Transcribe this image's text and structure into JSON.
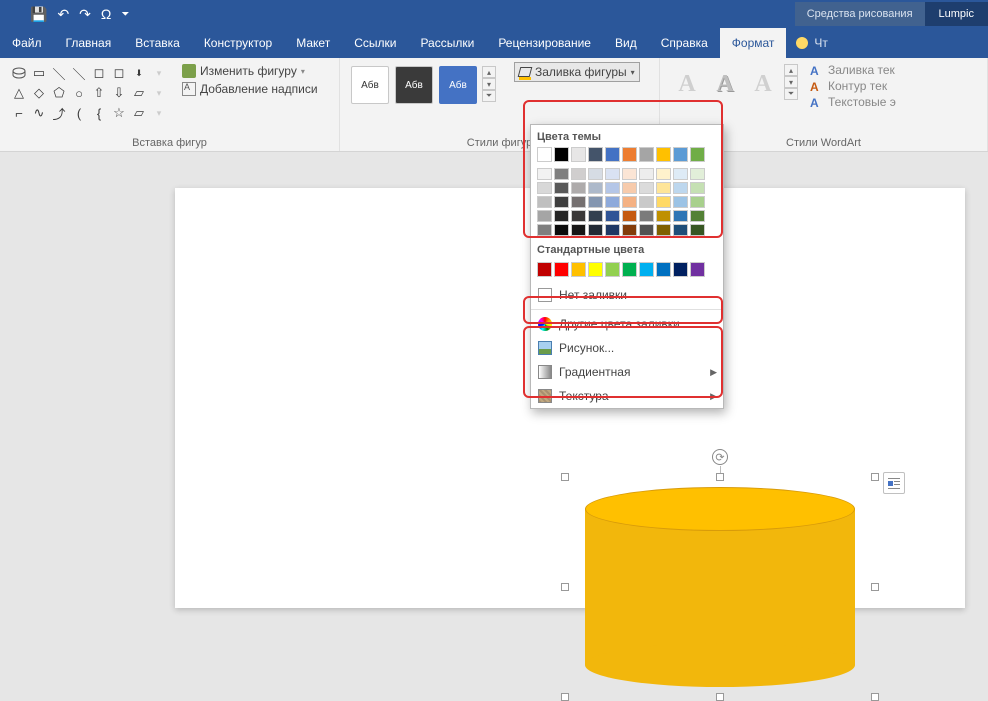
{
  "qat": {
    "save": "💾",
    "undo": "↶",
    "redo": "↷",
    "omega": "Ω",
    "more": "⏷"
  },
  "titlebar": {
    "tools": "Средства рисования",
    "brand": "Lumpic"
  },
  "menu": {
    "file": "Файл",
    "home": "Главная",
    "insert": "Вставка",
    "design": "Конструктор",
    "layout": "Макет",
    "refs": "Ссылки",
    "mail": "Рассылки",
    "review": "Рецензирование",
    "view": "Вид",
    "help": "Справка",
    "format": "Формат",
    "tellme": "Чт"
  },
  "ribbon": {
    "shapes_group": "Вставка фигур",
    "edit_shape": "Изменить фигуру",
    "add_text": "Добавление надписи",
    "styles_group": "Стили фигур",
    "preset": "Абв",
    "fill": "Заливка фигуры",
    "wordart_group": "Стили WordArt",
    "wa": "A",
    "wa_fill": "Заливка тек",
    "wa_outline": "Контур тек",
    "wa_effects": "Текстовые э"
  },
  "dropdown": {
    "theme_title": "Цвета темы",
    "theme_top": [
      "#ffffff",
      "#000000",
      "#e7e6e6",
      "#44546a",
      "#4472c4",
      "#ed7d31",
      "#a5a5a5",
      "#ffc000",
      "#5b9bd5",
      "#70ad47"
    ],
    "theme_shades": [
      [
        "#f2f2f2",
        "#7f7f7f",
        "#d0cece",
        "#d6dce4",
        "#d9e2f3",
        "#fbe5d5",
        "#ededed",
        "#fff2cc",
        "#deebf6",
        "#e2efd9"
      ],
      [
        "#d8d8d8",
        "#595959",
        "#aeabab",
        "#adb9ca",
        "#b4c6e7",
        "#f7cbac",
        "#dbdbdb",
        "#fee599",
        "#bdd7ee",
        "#c5e0b3"
      ],
      [
        "#bfbfbf",
        "#3f3f3f",
        "#757070",
        "#8496b0",
        "#8eaadb",
        "#f4b183",
        "#c9c9c9",
        "#ffd965",
        "#9cc3e5",
        "#a8d08d"
      ],
      [
        "#a5a5a5",
        "#262626",
        "#3a3838",
        "#323f4f",
        "#2f5496",
        "#c55a11",
        "#7b7b7b",
        "#bf9000",
        "#2e75b5",
        "#538135"
      ],
      [
        "#7f7f7f",
        "#0c0c0c",
        "#171616",
        "#222a35",
        "#1f3864",
        "#833c0b",
        "#525252",
        "#7f6000",
        "#1e4e79",
        "#375623"
      ]
    ],
    "std_title": "Стандартные цвета",
    "std": [
      "#c00000",
      "#ff0000",
      "#ffc000",
      "#ffff00",
      "#92d050",
      "#00b050",
      "#00b0f0",
      "#0070c0",
      "#002060",
      "#7030a0"
    ],
    "no_fill": "Нет заливки",
    "more": "Другие цвета заливки...",
    "picture": "Рисунок...",
    "gradient": "Градиентная",
    "texture": "Текстура"
  }
}
